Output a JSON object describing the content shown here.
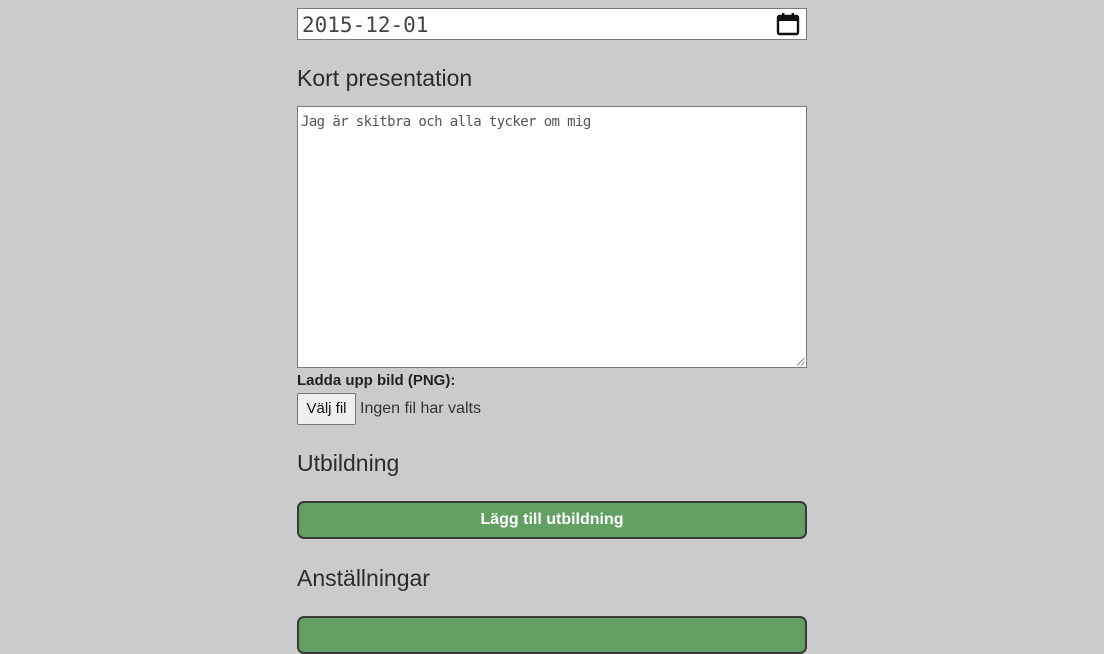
{
  "date_field": {
    "value": "2015-12-01",
    "icon": "calendar-icon"
  },
  "presentation": {
    "heading": "Kort presentation",
    "textarea_value": "Jag är skitbra och alla tycker om mig"
  },
  "upload": {
    "label": "Ladda upp bild (PNG):",
    "button_label": "Välj fil",
    "status": "Ingen fil har valts"
  },
  "education": {
    "heading": "Utbildning",
    "add_button_label": "Lägg till utbildning"
  },
  "employment": {
    "heading": "Anställningar",
    "add_button_label": ""
  },
  "colors": {
    "background": "#cbcbcb",
    "button_green": "#63a064",
    "button_border": "#3a3a3a"
  }
}
